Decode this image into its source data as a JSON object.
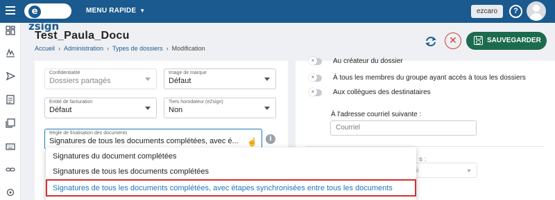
{
  "topbar": {
    "logo": "ezsign",
    "menu_label": "MENU RAPIDE",
    "user": "ezcaro",
    "help": "?"
  },
  "header": {
    "title": "Test_Paula_Docu",
    "breadcrumb": [
      "Accueil",
      "Administration",
      "Types de dossiers",
      "Modification"
    ],
    "save_label": "SAUVEGARDER"
  },
  "form": {
    "confidentialite": {
      "label": "Confidentialité",
      "value": "Dossiers partagés"
    },
    "image_marque": {
      "label": "Image de marque",
      "value": "Défaut"
    },
    "entite_facturation": {
      "label": "Entité de facturation",
      "value": "Défaut"
    },
    "tiers_horodateur": {
      "label": "Tiers horodateur (eZsign)",
      "value": "Non"
    },
    "regle_finalisation": {
      "label": "Règle de finalisation des documents",
      "value": "Signatures de tous les documents complétées, avec é..."
    }
  },
  "notifications": {
    "toggles": [
      {
        "label": "Au créateur du dossier"
      },
      {
        "label": "À tous les membres du groupe ayant accès à tous les dossiers"
      },
      {
        "label": "Aux collègues des destinataires"
      }
    ],
    "email_label": "À l'adresse courriel suivante :",
    "email_placeholder": "Courriel",
    "partial_label": "s :",
    "partial_value": "né"
  },
  "dropdown": {
    "options": [
      "Signatures du document complétées",
      "Signatures de tous les documents complétées",
      "Signatures de tous les documents complétées, avec étapes synchronisées entre tous les documents"
    ]
  },
  "colors": {
    "topbar": "#1a5a8e",
    "save_button": "#1c6b4e",
    "cancel": "#d23a3a",
    "highlight_border": "#d32f2f",
    "link": "#1a5a8e"
  },
  "icons": [
    "menu-icon",
    "sync-icon",
    "close-icon",
    "save-icon",
    "help-icon",
    "info-icon",
    "dashboard-icon",
    "signature-icon",
    "send-icon",
    "document-icon",
    "documents-icon",
    "keyboard-icon",
    "link-icon",
    "settings-icon"
  ]
}
